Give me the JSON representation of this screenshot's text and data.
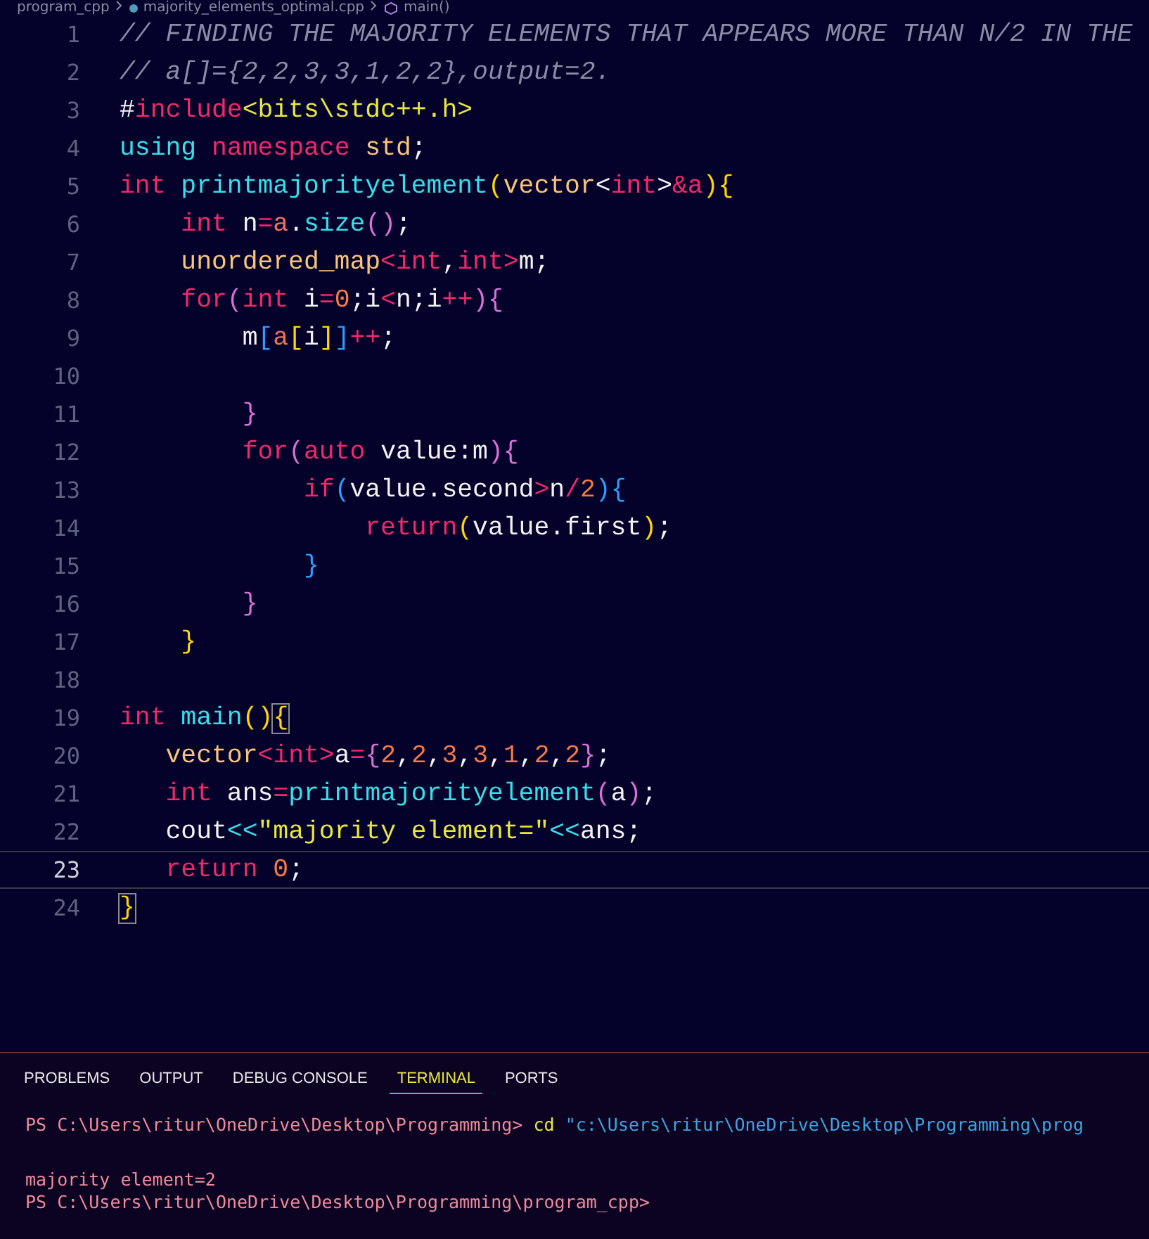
{
  "breadcrumb": [
    {
      "label": "program_cpp",
      "kind": "folder"
    },
    {
      "label": "majority_elements_optimal.cpp",
      "kind": "file"
    },
    {
      "label": "main()",
      "kind": "symbol"
    }
  ],
  "editor": {
    "lines": [
      {
        "number": "1",
        "current": false,
        "tokens": [
          {
            "text": "// FINDING THE MAJORITY ELEMENTS THAT APPEARS MORE THAN N/2 IN THE",
            "kind": "comment"
          }
        ]
      },
      {
        "number": "2",
        "current": false,
        "tokens": [
          {
            "text": "// a[]={2,2,3,3,1,2,2},output=2.",
            "kind": "comment"
          }
        ]
      },
      {
        "number": "3",
        "current": false,
        "tokens": [
          {
            "text": "#",
            "kind": "plain"
          },
          {
            "text": "include",
            "kind": "keyword"
          },
          {
            "text": "<bits\\stdc++.h>",
            "kind": "string"
          }
        ]
      },
      {
        "number": "4",
        "current": false,
        "tokens": [
          {
            "text": "using ",
            "kind": "function"
          },
          {
            "text": "namespace",
            "kind": "keyword"
          },
          {
            "text": " std",
            "kind": "type"
          },
          {
            "text": ";",
            "kind": "plain"
          }
        ]
      },
      {
        "number": "5",
        "current": false,
        "tokens": [
          {
            "text": "int ",
            "kind": "keyword"
          },
          {
            "text": "printmajorityelement",
            "kind": "function"
          },
          {
            "text": "(",
            "kind": "bracket-gold"
          },
          {
            "text": "vector",
            "kind": "type"
          },
          {
            "text": "<",
            "kind": "plain"
          },
          {
            "text": "int",
            "kind": "keyword"
          },
          {
            "text": ">",
            "kind": "plain"
          },
          {
            "text": "&a",
            "kind": "keyword"
          },
          {
            "text": "){",
            "kind": "bracket-gold"
          }
        ]
      },
      {
        "number": "6",
        "current": false,
        "tokens": [
          {
            "text": "    int",
            "kind": "keyword"
          },
          {
            "text": " n",
            "kind": "plain"
          },
          {
            "text": "=",
            "kind": "operator"
          },
          {
            "text": "a",
            "kind": "param"
          },
          {
            "text": ".",
            "kind": "plain"
          },
          {
            "text": "size",
            "kind": "function"
          },
          {
            "text": "()",
            "kind": "bracket-orchid"
          },
          {
            "text": ";",
            "kind": "plain"
          }
        ]
      },
      {
        "number": "7",
        "current": false,
        "tokens": [
          {
            "text": "    unordered_map",
            "kind": "type"
          },
          {
            "text": "<",
            "kind": "operator"
          },
          {
            "text": "int",
            "kind": "keyword"
          },
          {
            "text": ",",
            "kind": "plain"
          },
          {
            "text": "int",
            "kind": "keyword"
          },
          {
            "text": ">",
            "kind": "operator"
          },
          {
            "text": "m;",
            "kind": "plain"
          }
        ]
      },
      {
        "number": "8",
        "current": false,
        "tokens": [
          {
            "text": "    for",
            "kind": "keyword"
          },
          {
            "text": "(",
            "kind": "bracket-orchid"
          },
          {
            "text": "int",
            "kind": "keyword"
          },
          {
            "text": " i",
            "kind": "plain"
          },
          {
            "text": "=",
            "kind": "operator"
          },
          {
            "text": "0",
            "kind": "number"
          },
          {
            "text": ";i",
            "kind": "plain"
          },
          {
            "text": "<",
            "kind": "operator"
          },
          {
            "text": "n;i",
            "kind": "plain"
          },
          {
            "text": "++",
            "kind": "operator"
          },
          {
            "text": "){",
            "kind": "bracket-orchid"
          }
        ]
      },
      {
        "number": "9",
        "current": false,
        "tokens": [
          {
            "text": "        m",
            "kind": "plain"
          },
          {
            "text": "[",
            "kind": "bracket-blue"
          },
          {
            "text": "a",
            "kind": "param"
          },
          {
            "text": "[",
            "kind": "bracket-gold"
          },
          {
            "text": "i",
            "kind": "plain"
          },
          {
            "text": "]",
            "kind": "bracket-gold"
          },
          {
            "text": "]",
            "kind": "bracket-blue"
          },
          {
            "text": "++",
            "kind": "operator"
          },
          {
            "text": ";",
            "kind": "plain"
          }
        ]
      },
      {
        "number": "10",
        "current": false
      },
      {
        "number": "11",
        "current": false,
        "tokens": [
          {
            "text": "        }",
            "kind": "bracket-orchid"
          }
        ]
      },
      {
        "number": "12",
        "current": false,
        "tokens": [
          {
            "text": "        for",
            "kind": "keyword"
          },
          {
            "text": "(",
            "kind": "bracket-orchid"
          },
          {
            "text": "auto",
            "kind": "keyword"
          },
          {
            "text": " value:m",
            "kind": "plain"
          },
          {
            "text": "){",
            "kind": "bracket-orchid"
          }
        ]
      },
      {
        "number": "13",
        "current": false,
        "tokens": [
          {
            "text": "            if",
            "kind": "keyword"
          },
          {
            "text": "(",
            "kind": "bracket-blue"
          },
          {
            "text": "value.second",
            "kind": "plain"
          },
          {
            "text": ">",
            "kind": "operator"
          },
          {
            "text": "n",
            "kind": "plain"
          },
          {
            "text": "/",
            "kind": "operator"
          },
          {
            "text": "2",
            "kind": "number"
          },
          {
            "text": "){",
            "kind": "bracket-blue"
          }
        ]
      },
      {
        "number": "14",
        "current": false,
        "tokens": [
          {
            "text": "                return",
            "kind": "keyword"
          },
          {
            "text": "(",
            "kind": "bracket-gold"
          },
          {
            "text": "value.first",
            "kind": "plain"
          },
          {
            "text": ")",
            "kind": "bracket-gold"
          },
          {
            "text": ";",
            "kind": "plain"
          }
        ]
      },
      {
        "number": "15",
        "current": false,
        "tokens": [
          {
            "text": "            }",
            "kind": "bracket-blue"
          }
        ]
      },
      {
        "number": "16",
        "current": false,
        "tokens": [
          {
            "text": "        }",
            "kind": "bracket-orchid"
          }
        ]
      },
      {
        "number": "17",
        "current": false,
        "tokens": [
          {
            "text": "    }",
            "kind": "bracket-gold"
          }
        ]
      },
      {
        "number": "18",
        "current": false
      },
      {
        "number": "19",
        "current": false,
        "tokens": [
          {
            "text": "int ",
            "kind": "keyword"
          },
          {
            "text": "main",
            "kind": "function"
          },
          {
            "text": "()",
            "kind": "bracket-gold"
          },
          {
            "text": "{",
            "kind": "bracket-match"
          }
        ]
      },
      {
        "number": "20",
        "current": false,
        "tokens": [
          {
            "text": "   vector",
            "kind": "type"
          },
          {
            "text": "<",
            "kind": "operator"
          },
          {
            "text": "int",
            "kind": "keyword"
          },
          {
            "text": ">",
            "kind": "operator"
          },
          {
            "text": "a",
            "kind": "plain"
          },
          {
            "text": "=",
            "kind": "operator"
          },
          {
            "text": "{",
            "kind": "bracket-orchid"
          },
          {
            "text": "2",
            "kind": "number"
          },
          {
            "text": ",",
            "kind": "plain"
          },
          {
            "text": "2",
            "kind": "number"
          },
          {
            "text": ",",
            "kind": "plain"
          },
          {
            "text": "3",
            "kind": "number"
          },
          {
            "text": ",",
            "kind": "plain"
          },
          {
            "text": "3",
            "kind": "number"
          },
          {
            "text": ",",
            "kind": "plain"
          },
          {
            "text": "1",
            "kind": "number"
          },
          {
            "text": ",",
            "kind": "plain"
          },
          {
            "text": "2",
            "kind": "number"
          },
          {
            "text": ",",
            "kind": "plain"
          },
          {
            "text": "2",
            "kind": "number"
          },
          {
            "text": "}",
            "kind": "bracket-orchid"
          },
          {
            "text": ";",
            "kind": "plain"
          }
        ]
      },
      {
        "number": "21",
        "current": false,
        "tokens": [
          {
            "text": "   int",
            "kind": "keyword"
          },
          {
            "text": " ans",
            "kind": "plain"
          },
          {
            "text": "=",
            "kind": "operator"
          },
          {
            "text": "printmajorityelement",
            "kind": "function"
          },
          {
            "text": "(",
            "kind": "bracket-orchid"
          },
          {
            "text": "a",
            "kind": "plain"
          },
          {
            "text": ")",
            "kind": "bracket-orchid"
          },
          {
            "text": ";",
            "kind": "plain"
          }
        ]
      },
      {
        "number": "22",
        "current": false,
        "tokens": [
          {
            "text": "   cout",
            "kind": "plain"
          },
          {
            "text": "<<",
            "kind": "stream"
          },
          {
            "text": "\"majority element=\"",
            "kind": "string"
          },
          {
            "text": "<<",
            "kind": "stream"
          },
          {
            "text": "ans;",
            "kind": "plain"
          }
        ]
      },
      {
        "number": "23",
        "current": true,
        "tokens": [
          {
            "text": "   return ",
            "kind": "keyword"
          },
          {
            "text": "0",
            "kind": "number"
          },
          {
            "text": ";",
            "kind": "plain"
          }
        ]
      },
      {
        "number": "24",
        "current": false,
        "tokens": [
          {
            "text": "}",
            "kind": "bracket-match"
          }
        ]
      }
    ]
  },
  "panel": {
    "tabs": [
      {
        "label": "PROBLEMS",
        "selected": false
      },
      {
        "label": "OUTPUT",
        "selected": false
      },
      {
        "label": "DEBUG CONSOLE",
        "selected": false
      },
      {
        "label": "TERMINAL",
        "selected": true
      },
      {
        "label": "PORTS",
        "selected": false
      }
    ],
    "terminal_lines": [
      {
        "tokens": [
          {
            "text": "PS C:\\Users\\ritur\\OneDrive\\Desktop\\Programming> ",
            "kind": "prompt"
          },
          {
            "text": "cd",
            "kind": "command"
          },
          {
            "text": " \"c:\\Users\\ritur\\OneDrive\\Desktop\\Programming\\prog",
            "kind": "path"
          }
        ]
      },
      {
        "tokens": [
          {
            "text": "majority element=2",
            "kind": "prompt"
          }
        ]
      },
      {
        "tokens": [
          {
            "text": "PS C:\\Users\\ritur\\OneDrive\\Desktop\\Programming\\program_cpp>",
            "kind": "prompt"
          }
        ]
      }
    ]
  }
}
